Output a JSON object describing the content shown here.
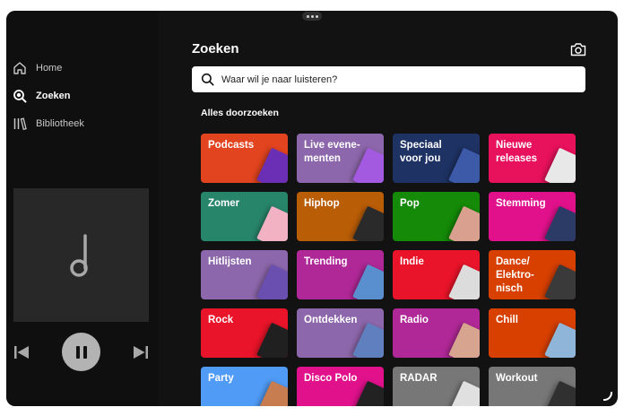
{
  "sidebar": {
    "items": [
      {
        "label": "Home",
        "icon": "home-icon",
        "active": false
      },
      {
        "label": "Zoeken",
        "icon": "search-icon",
        "active": true
      },
      {
        "label": "Bibliotheek",
        "icon": "library-icon",
        "active": false
      }
    ]
  },
  "player": {
    "artwork_icon": "music-note-icon",
    "prev_icon": "skip-previous-icon",
    "play_pause_icon": "pause-icon",
    "next_icon": "skip-next-icon"
  },
  "main": {
    "title": "Zoeken",
    "camera_icon": "camera-icon",
    "search": {
      "placeholder": "Waar wil je naar luisteren?",
      "value": ""
    },
    "section_title": "Alles doorzoeken",
    "tiles": [
      {
        "label": "Podcasts",
        "color": "#e1441f",
        "art": "#6b2fb5"
      },
      {
        "label": "Live evene-menten",
        "color": "#8d67ab",
        "art": "#a45ae0"
      },
      {
        "label": "Speciaal voor jou",
        "color": "#1e3264",
        "art": "#3c5aa8"
      },
      {
        "label": "Nieuwe releases",
        "color": "#e8115b",
        "art": "#e8e8e8"
      },
      {
        "label": "Zomer",
        "color": "#27856a",
        "art": "#f3b2c4"
      },
      {
        "label": "Hiphop",
        "color": "#ba5d07",
        "art": "#2a2a2a"
      },
      {
        "label": "Pop",
        "color": "#148a08",
        "art": "#d9a08f"
      },
      {
        "label": "Stemming",
        "color": "#e1118c",
        "art": "#2c3a66"
      },
      {
        "label": "Hitlijsten",
        "color": "#8d67ab",
        "art": "#6a4fb0"
      },
      {
        "label": "Trending",
        "color": "#b02897",
        "art": "#5a8fcf"
      },
      {
        "label": "Indie",
        "color": "#e91429",
        "art": "#dcdcdc"
      },
      {
        "label": "Dance/ Elektro-nisch",
        "color": "#d84000",
        "art": "#3a3a3a"
      },
      {
        "label": "Rock",
        "color": "#e91429",
        "art": "#202020"
      },
      {
        "label": "Ontdekken",
        "color": "#8d67ab",
        "art": "#5f7fbf"
      },
      {
        "label": "Radio",
        "color": "#b02897",
        "art": "#d6a48f"
      },
      {
        "label": "Chill",
        "color": "#d84000",
        "art": "#8fb6d9"
      },
      {
        "label": "Party",
        "color": "#509bf5",
        "art": "#c77d4f"
      },
      {
        "label": "Disco Polo",
        "color": "#e1118c",
        "art": "#222222"
      },
      {
        "label": "RADAR",
        "color": "#777777",
        "art": "#e0e0e0"
      },
      {
        "label": "Workout",
        "color": "#777777",
        "art": "#303030"
      }
    ]
  }
}
